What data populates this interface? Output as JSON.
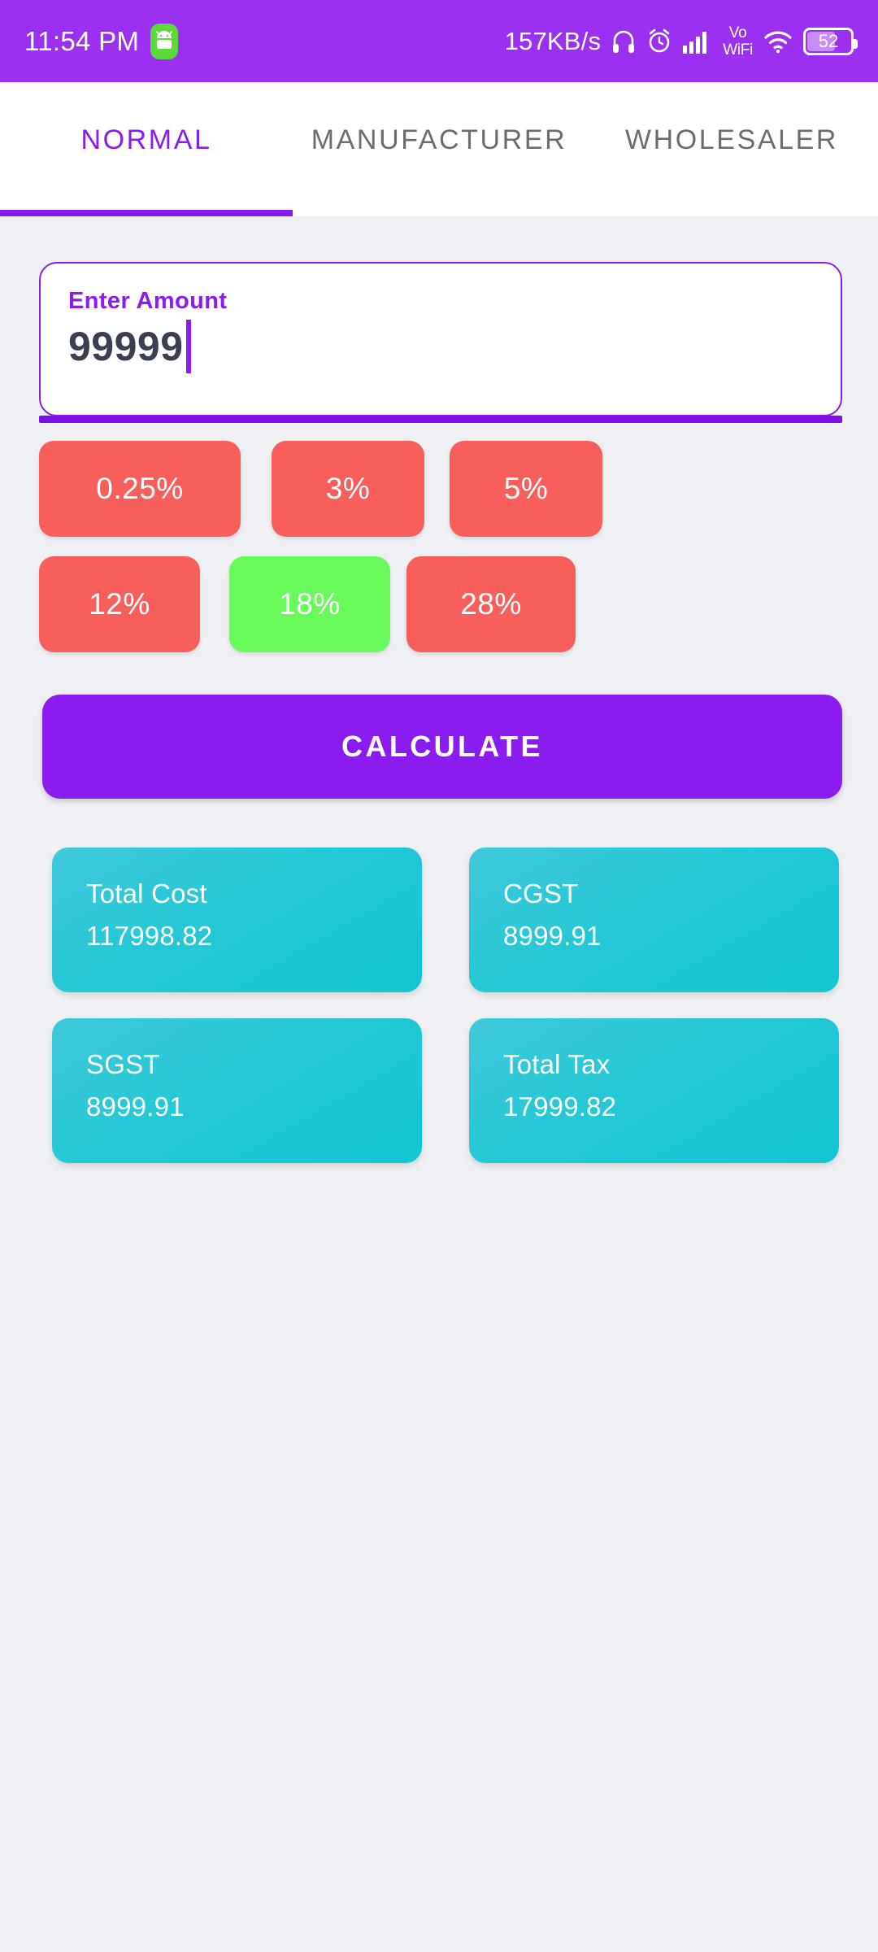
{
  "status_bar": {
    "time": "11:54 PM",
    "android_icon": "android-robot-icon",
    "network_speed": "157KB/s",
    "icons": [
      "headphones-icon",
      "alarm-clock-icon",
      "signal-bars-icon",
      "volte-wifi-icon",
      "wifi-icon"
    ],
    "volte_line1": "Vo",
    "volte_line2": "WiFi",
    "battery_level": "52",
    "background_color": "#9B30F0"
  },
  "tabs": {
    "items": [
      {
        "label": "NORMAL",
        "active": true
      },
      {
        "label": "MANUFACTURER",
        "active": false
      },
      {
        "label": "WHOLESALER",
        "active": false
      }
    ],
    "active_color": "#8A1CF0",
    "inactive_color": "#6D6D6D"
  },
  "amount_input": {
    "label": "Enter Amount",
    "value": "99999",
    "placeholder": "Enter Amount",
    "border_color": "#8A1CF0"
  },
  "rate_buttons": {
    "row1": [
      {
        "label": "0.25%",
        "selected": false
      },
      {
        "label": "3%",
        "selected": false
      },
      {
        "label": "5%",
        "selected": false
      }
    ],
    "row2": [
      {
        "label": "12%",
        "selected": false
      },
      {
        "label": "18%",
        "selected": true
      },
      {
        "label": "28%",
        "selected": false
      }
    ],
    "unselected_color": "#F95F5A",
    "selected_color": "#68F95A"
  },
  "calculate": {
    "label": "CALCULATE",
    "color": "#8A1CF0"
  },
  "results": {
    "row1": [
      {
        "title": "Total Cost",
        "value": "117998.82"
      },
      {
        "title": "CGST",
        "value": "8999.91"
      }
    ],
    "row2": [
      {
        "title": "SGST",
        "value": "8999.91"
      },
      {
        "title": "Total Tax",
        "value": "17999.82"
      }
    ],
    "card_color": "#24C8D6"
  }
}
